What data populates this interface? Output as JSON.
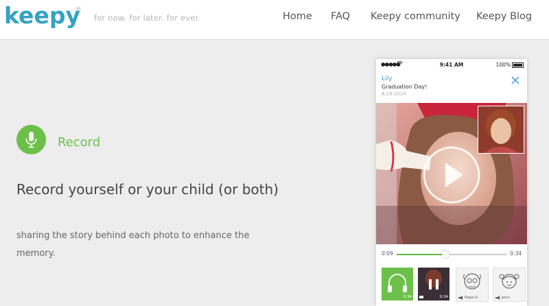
{
  "header": {
    "logo_text": "keepy",
    "tagline": "for now. for later. for ever.",
    "nav": [
      {
        "label": "Home"
      },
      {
        "label": "FAQ"
      },
      {
        "label": "Keepy community"
      },
      {
        "label": "Keepy Blog"
      }
    ]
  },
  "feature": {
    "icon": "microphone-icon",
    "label": "Record",
    "headline": "Record yourself or your child (or both)",
    "description": "sharing the story behind each photo to enhance the memory."
  },
  "phone": {
    "status": {
      "signal": "●●●●●",
      "time": "9:41 AM",
      "battery": "100%"
    },
    "post": {
      "name": "Lily",
      "title": "Graduation Day!",
      "date": "6.19.2014"
    },
    "player": {
      "elapsed": "0:09",
      "duration": "0:34",
      "progress_fraction": 0.45
    },
    "comments": [
      {
        "type": "audio",
        "icon": "headphones-icon",
        "length": "0:34"
      },
      {
        "type": "video",
        "icon": "pause-icon",
        "length": "0:34"
      },
      {
        "type": "audio",
        "icon": "speaker-icon",
        "author": "Papa D."
      },
      {
        "type": "audio",
        "icon": "speaker-icon",
        "author": "Jenn"
      }
    ]
  },
  "colors": {
    "accent_green": "#6cc04a",
    "logo_teal": "#36a2c2",
    "link_blue": "#3b9ad6"
  }
}
